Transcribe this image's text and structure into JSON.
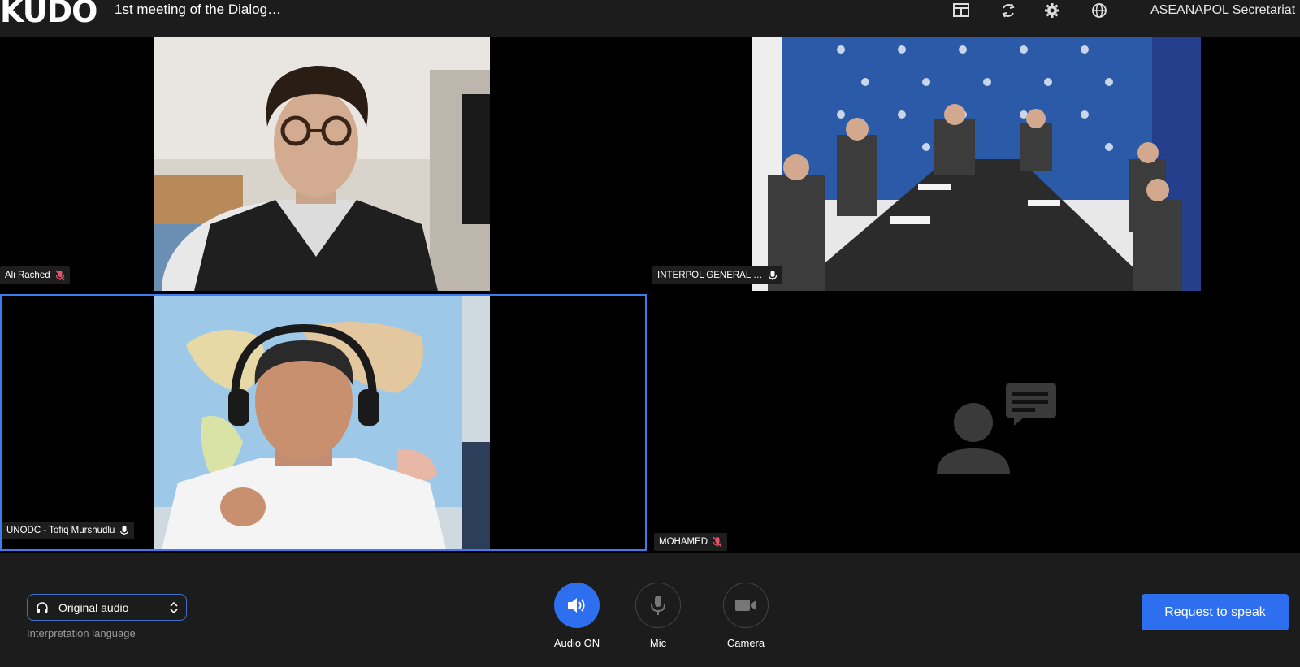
{
  "header": {
    "logo_text": "KUDO",
    "meeting_title": "1st meeting of the Dialog…",
    "org_name": "ASEANAPOL Secretariat",
    "icons": [
      "layout-icon",
      "refresh-icon",
      "gear-icon",
      "globe-icon"
    ]
  },
  "participants": [
    {
      "name": "Ali Rached",
      "mic": "muted"
    },
    {
      "name": "INTERPOL GENERAL …",
      "mic": "on"
    },
    {
      "name": "UNODC - Tofiq Murshudlu",
      "mic": "on"
    },
    {
      "name": "MOHAMED",
      "mic": "muted"
    }
  ],
  "controls": {
    "audio_select_value": "Original audio",
    "interpretation_label": "Interpretation language",
    "audio_label": "Audio ON",
    "mic_label": "Mic",
    "camera_label": "Camera",
    "request_label": "Request to speak"
  },
  "colors": {
    "accent": "#2e6ff0",
    "muted_mic": "#e0556b",
    "active_border": "#3d7bf0"
  }
}
